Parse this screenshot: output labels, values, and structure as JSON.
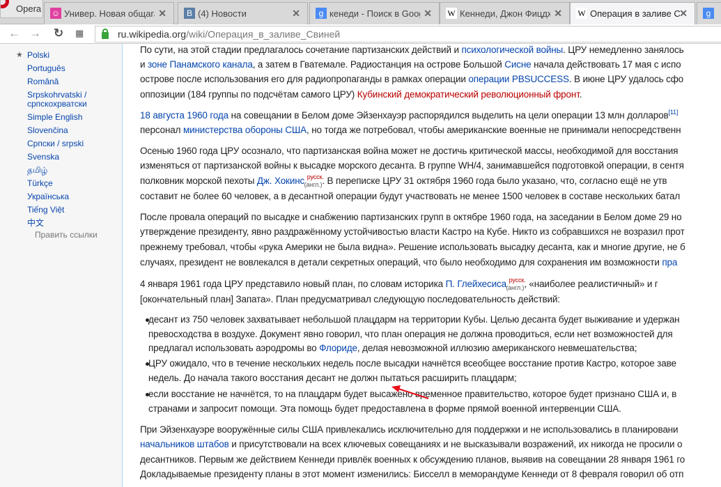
{
  "browser": {
    "menu_label": "Opera",
    "tabs": [
      {
        "label": "Универ. Новая общага /",
        "fav": "univer",
        "color": "#e040a0"
      },
      {
        "label": "(4) Новости",
        "fav": "vk",
        "color": "#5b7fa6"
      },
      {
        "label": "кенеди - Поиск в Google",
        "fav": "google",
        "color": "#4a8af4"
      },
      {
        "label": "Кеннеди, Джон Фицджер",
        "fav": "wikipedia",
        "color": "#ffffff"
      },
      {
        "label": "Операция в заливе Свин",
        "fav": "wikipedia",
        "color": "#ffffff"
      }
    ],
    "url_host": "ru.wikipedia.org",
    "url_path": "/wiki/Операция_в_заливе_Свиней"
  },
  "sidebar": {
    "languages": [
      "Polski",
      "Português",
      "Română",
      "Srpskohrvatski /",
      "српскохрватски",
      "Simple English",
      "Slovenčina",
      "Српски / srpski",
      "Svenska",
      "தமிழ்",
      "Türkçe",
      "Українська",
      "Tiếng Việt",
      "中文"
    ],
    "edit_links": "Править ссылки"
  },
  "lines": [
    [
      [
        "По сути, на этой стадии предлагалось сочетание партизанских действий и ",
        ""
      ],
      [
        "психологической войны",
        "link"
      ],
      [
        ". ЦРУ немедленно занялось",
        ""
      ]
    ],
    [
      [
        "и ",
        ""
      ],
      [
        "зоне Панамского канала",
        "link"
      ],
      [
        ", а затем в Гватемале. Радиостанция на острове Большой ",
        ""
      ],
      [
        "Сисне",
        "link"
      ],
      [
        " начала действовать 17 мая с испо",
        ""
      ]
    ],
    [
      [
        "острове после использования его для радиопропаганды в рамках операции ",
        ""
      ],
      [
        "операции PBSUCCESS",
        "link"
      ],
      [
        ". В июне ЦРУ удалось сфо",
        ""
      ]
    ],
    [
      [
        "оппозиции (184 группы по подсчётам самого ЦРУ) ",
        ""
      ],
      [
        "Кубинский демократический революционный фронт",
        "red"
      ],
      [
        ".",
        ""
      ]
    ],
    [
      [
        "18 августа 1960 года",
        "link"
      ],
      [
        " на совещании в Белом доме Эйзенхауэр распорядился выделить на цели операции 13 млн долларов",
        ""
      ],
      [
        "[11]",
        "sup"
      ]
    ],
    [
      [
        "персонал ",
        ""
      ],
      [
        "министерства обороны США",
        "link"
      ],
      [
        ", но тогда же потребовал, чтобы американские военные не принимали непосредственн",
        ""
      ]
    ],
    [
      [
        "Осенью 1960 года ЦРУ осознало, что партизанская война может не достичь критической массы, необходимой для восстания",
        ""
      ]
    ],
    [
      [
        "изменяться от партизанской войны к высадке морского десанта. В группе WH/4, занимавшейся подготовкой операции, в сентя",
        ""
      ]
    ],
    [
      [
        "полковник морской пехоты ",
        ""
      ],
      [
        "Дж. Хокинс",
        "link"
      ],
      [
        " ",
        ""
      ],
      [
        "русск.",
        "ia"
      ],
      [
        "(англ.)",
        "ia2"
      ],
      [
        ". В переписке ЦРУ 31 октября 1960 года было указано, что, согласно ещё не утв",
        ""
      ]
    ],
    [
      [
        "составит не более 60 человек, а в десантной операции будут участвовать не менее 1500 человек в составе нескольких батал",
        ""
      ]
    ],
    [
      [
        "После провала операций по высадке и снабжению партизанских групп в октябре 1960 года, на заседании в Белом доме 29 но",
        ""
      ]
    ],
    [
      [
        "утверждение президенту, явно раздражённому устойчивостью власти Кастро на Кубе. Никто из собравшихся не возразил прот",
        ""
      ]
    ],
    [
      [
        "прежнему требовал, чтобы «рука Америки не была видна». Решение использовать высадку десанта, как и многие другие, не б",
        ""
      ]
    ],
    [
      [
        "случаях, президент не вовлекался в детали секретных операций, что было необходимо для сохранения им возможности ",
        ""
      ],
      [
        "пра",
        "link"
      ]
    ],
    [
      [
        "4 января 1961 года ЦРУ представило новый план, по словам историка ",
        ""
      ],
      [
        "П. Глейхесиса",
        "link"
      ],
      [
        " ",
        ""
      ],
      [
        "русск.",
        "ia"
      ],
      [
        "(англ.)",
        "ia2"
      ],
      [
        ", «наиболее реалистичный» и г",
        ""
      ]
    ],
    [
      [
        "[окончательный план] Запата». План предусматривал следующую последовательность действий:",
        ""
      ]
    ],
    [
      [
        "десант из 750 человек захватывает небольшой плацдарм на территории Кубы. Целью десанта будет выживание и удержан",
        ""
      ]
    ],
    [
      [
        "превосходства в воздухе. Документ явно говорил, что план операция не должна проводиться, если нет возможностей для",
        ""
      ]
    ],
    [
      [
        "предлагал использовать аэродромы во ",
        ""
      ],
      [
        "Флориде",
        "link"
      ],
      [
        ", делая невозможной иллюзию американского невмешательства;",
        ""
      ]
    ],
    [
      [
        "ЦРУ ожидало, что в течение нескольких недель после высадки начнётся всеобщее восстание против Кастро, которое заве",
        ""
      ]
    ],
    [
      [
        "недель. До начала такого восстания десант не должн пытаться расширить плацдарм;",
        ""
      ]
    ],
    [
      [
        "если восстание не начнётся, то на плацдарм будет высажено временное правительство, которое будет признано США и, в",
        ""
      ]
    ],
    [
      [
        "странами и запросит помощи. Эта помощь будет предоставлена в форме прямой военной интервенции США.",
        ""
      ]
    ],
    [
      [
        "При Эйзенхауэре вооружённые силы США привлекались исключительно для поддержки и не использовались в планировани",
        ""
      ]
    ],
    [
      [
        "начальников штабов",
        "link"
      ],
      [
        " и присутствовали на всех ключевых совещаниях и не высказывали возражений, их никогда не просили о",
        ""
      ]
    ],
    [
      [
        "десантников. Первым же действием Кеннеди привлёк военных к обсуждению планов, выявив на совещании 28 января 1961 го",
        ""
      ]
    ],
    [
      [
        "Докладываемые президенту планы в этот момент изменились: Бисселл в меморандуме Кеннеди от 8 февраля говорил об отп",
        ""
      ]
    ]
  ],
  "annotation_color": "#e8101a"
}
